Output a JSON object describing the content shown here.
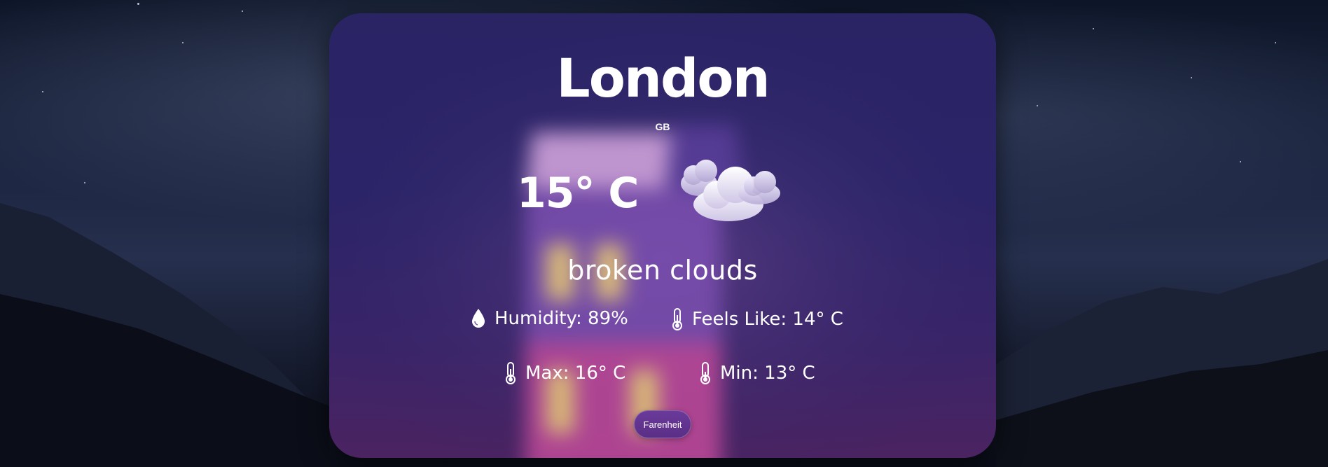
{
  "weather": {
    "city": "London",
    "country": "GB",
    "temperature": "15° C",
    "condition_icon": "broken-clouds-icon",
    "description": "broken clouds",
    "humidity_label": "Humidity: 89%",
    "feels_like_label": "Feels Like: 14° C",
    "max_label": "Max: 16° C",
    "min_label": "Min: 13° C"
  },
  "controls": {
    "unit_toggle_label": "Farenheit"
  },
  "icons": {
    "humidity": "droplet-icon",
    "feels_like": "thermometer-icon",
    "max": "thermometer-icon",
    "min": "thermometer-icon"
  },
  "colors": {
    "card_top": "#2a2465",
    "card_bottom": "#4b2361",
    "button": "#5a2e86",
    "text": "#ffffff"
  }
}
